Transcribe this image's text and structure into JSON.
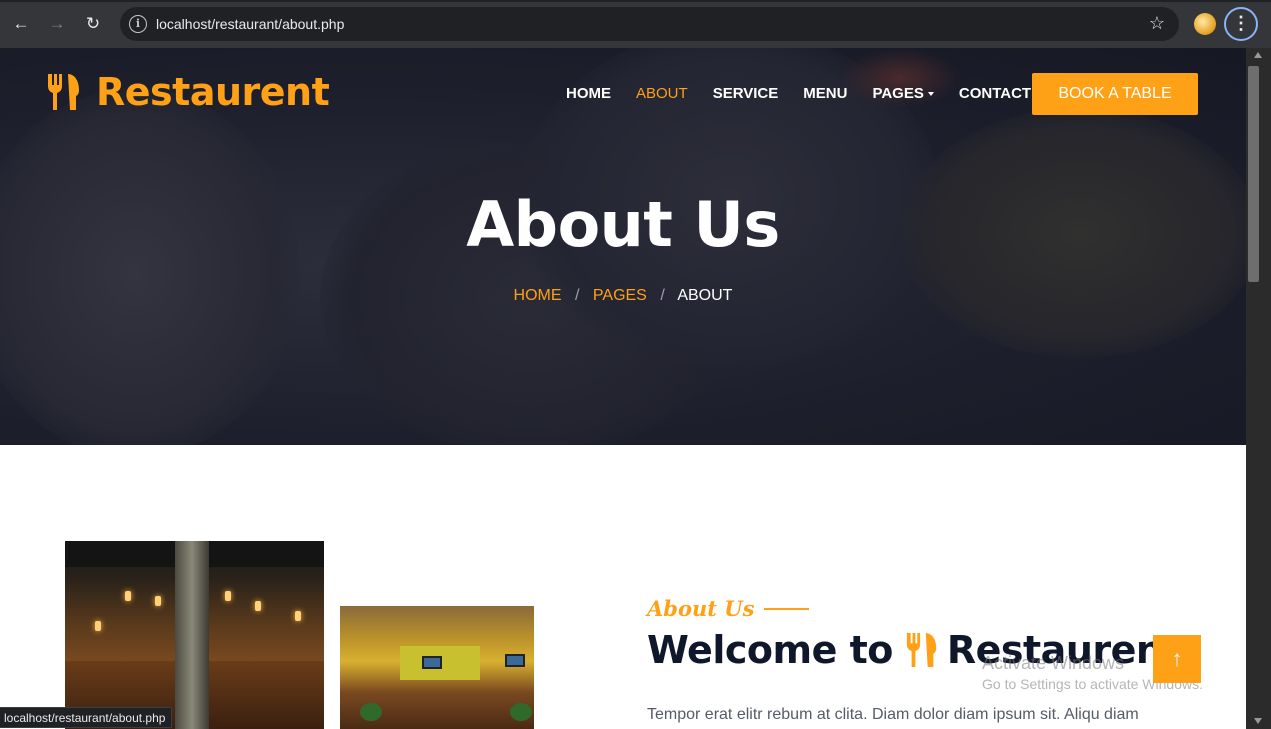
{
  "browser": {
    "url": "localhost/restaurant/about.php",
    "status_url": "localhost/restaurant/about.php",
    "icons": {
      "back": "arrow-left-icon",
      "forward": "arrow-right-icon",
      "reload": "reload-icon",
      "site_info": "info-icon",
      "bookmark": "star-icon",
      "profile": "avatar",
      "menu": "kebab-menu-icon"
    }
  },
  "site": {
    "brand": "Restaurent",
    "nav": [
      {
        "label": "HOME",
        "active": false
      },
      {
        "label": "ABOUT",
        "active": true
      },
      {
        "label": "SERVICE",
        "active": false
      },
      {
        "label": "MENU",
        "active": false
      },
      {
        "label": "PAGES",
        "active": false,
        "dropdown": true
      },
      {
        "label": "CONTACT",
        "active": false
      }
    ],
    "cta": "BOOK A TABLE"
  },
  "hero": {
    "title": "About Us",
    "breadcrumb": [
      "HOME",
      "PAGES",
      "ABOUT"
    ],
    "separator": "/"
  },
  "about": {
    "tag": "About Us",
    "welcome_prefix": "Welcome to",
    "welcome_brand": "Restaurent",
    "lede": "Tempor erat elitr rebum at clita. Diam dolor diam ipsum sit. Aliqu diam"
  },
  "overlay": {
    "activate_line1": "Activate Windows",
    "activate_line2": "Go to Settings to activate Windows."
  },
  "colors": {
    "accent": "#fea116",
    "dark": "#0f172b",
    "hero_bg": "#1d1f2c"
  }
}
